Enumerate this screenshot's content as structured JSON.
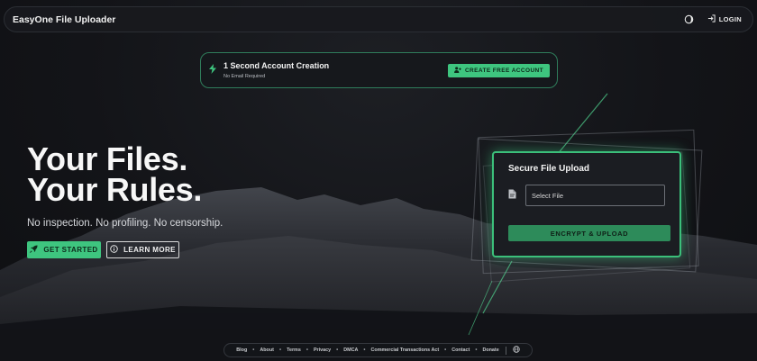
{
  "header": {
    "brand": "EasyOne File Uploader",
    "theme_icon": "moon-half-icon",
    "login_label": "LOGIN",
    "login_icon": "login-arrow-icon"
  },
  "promo": {
    "icon": "bolt-icon",
    "title": "1 Second Account Creation",
    "subtitle": "No Email Required",
    "button_label": "CREATE FREE ACCOUNT",
    "button_icon": "user-plus-icon"
  },
  "hero": {
    "title_line1": "Your Files.",
    "title_line2": "Your Rules.",
    "subtitle": "No inspection. No profiling. No censorship.",
    "primary_label": "GET STARTED",
    "primary_icon": "rocket-icon",
    "secondary_label": "LEARN MORE",
    "secondary_icon": "info-circle-icon"
  },
  "upload": {
    "title": "Secure File Upload",
    "file_icon": "file-icon",
    "file_placeholder": "Select File",
    "submit_label": "ENCRYPT & UPLOAD"
  },
  "footer": {
    "links": [
      "Blog",
      "About",
      "Terms",
      "Privacy",
      "DMCA",
      "Commercial Transactions Act",
      "Contact",
      "Donate"
    ],
    "globe_icon": "globe-icon"
  },
  "colors": {
    "accent": "#3ec57f",
    "background": "#121316",
    "card": "#1b1d22"
  }
}
